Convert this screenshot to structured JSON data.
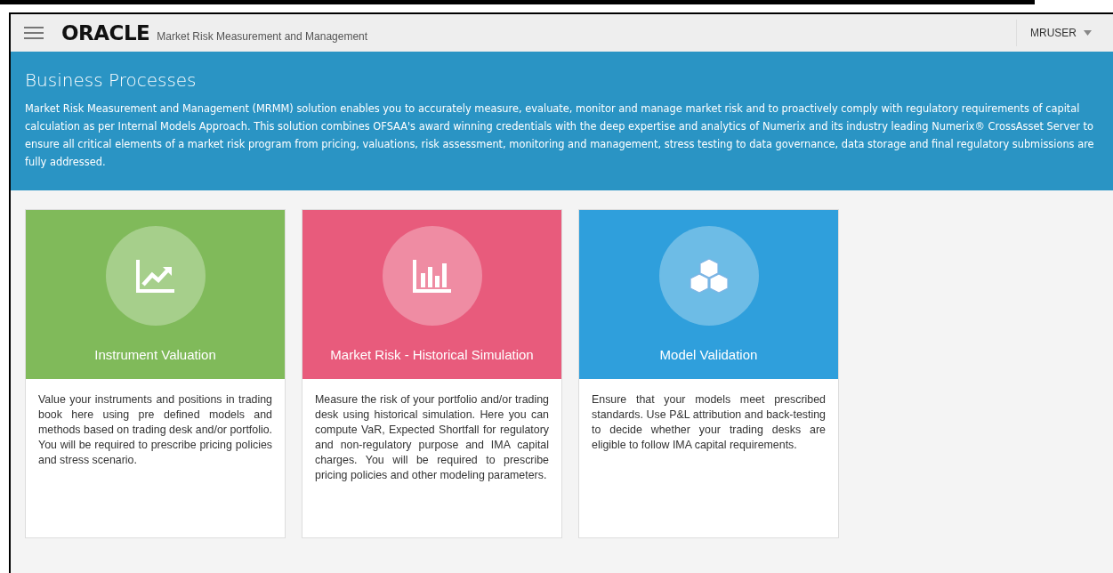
{
  "header": {
    "brand": "ORACLE",
    "app_title": "Market Risk Measurement and Management",
    "user": "MRUSER"
  },
  "banner": {
    "title": "Business Processes",
    "description": "Market Risk Measurement and Management (MRMM) solution enables you to accurately measure, evaluate, monitor and manage market risk and to proactively comply with regulatory requirements of capital calculation as per Internal Models Approach. This solution combines OFSAA's award winning credentials with the deep expertise and analytics of Numerix and its industry leading Numerix® CrossAsset Server to ensure all critical elements of a market risk program from pricing, valuations, risk assessment, monitoring and management, stress testing to data governance, data storage and final regulatory submissions are fully addressed."
  },
  "cards": [
    {
      "kind": "trend",
      "color": "#80ba5a",
      "title": "Instrument Valuation",
      "description": "Value your instruments and positions in trading book here using pre defined models and methods based on trading desk and/or portfolio. You will be required to prescribe pricing policies and stress scenario."
    },
    {
      "kind": "bars",
      "color": "#e85b7c",
      "title": "Market Risk - Historical Simulation",
      "description": "Measure the risk of your portfolio and/or trading desk using historical simulation. Here you can compute VaR, Expected Shortfall for regulatory and non-regulatory purpose and IMA capital charges. You will be required to prescribe pricing policies and other modeling parameters."
    },
    {
      "kind": "cubes",
      "color": "#2f9fdc",
      "title": "Model Validation",
      "description": "Ensure that your models meet prescribed standards. Use P&L attribution and back-testing to decide whether your trading desks are eligible to follow IMA capital requirements."
    }
  ]
}
